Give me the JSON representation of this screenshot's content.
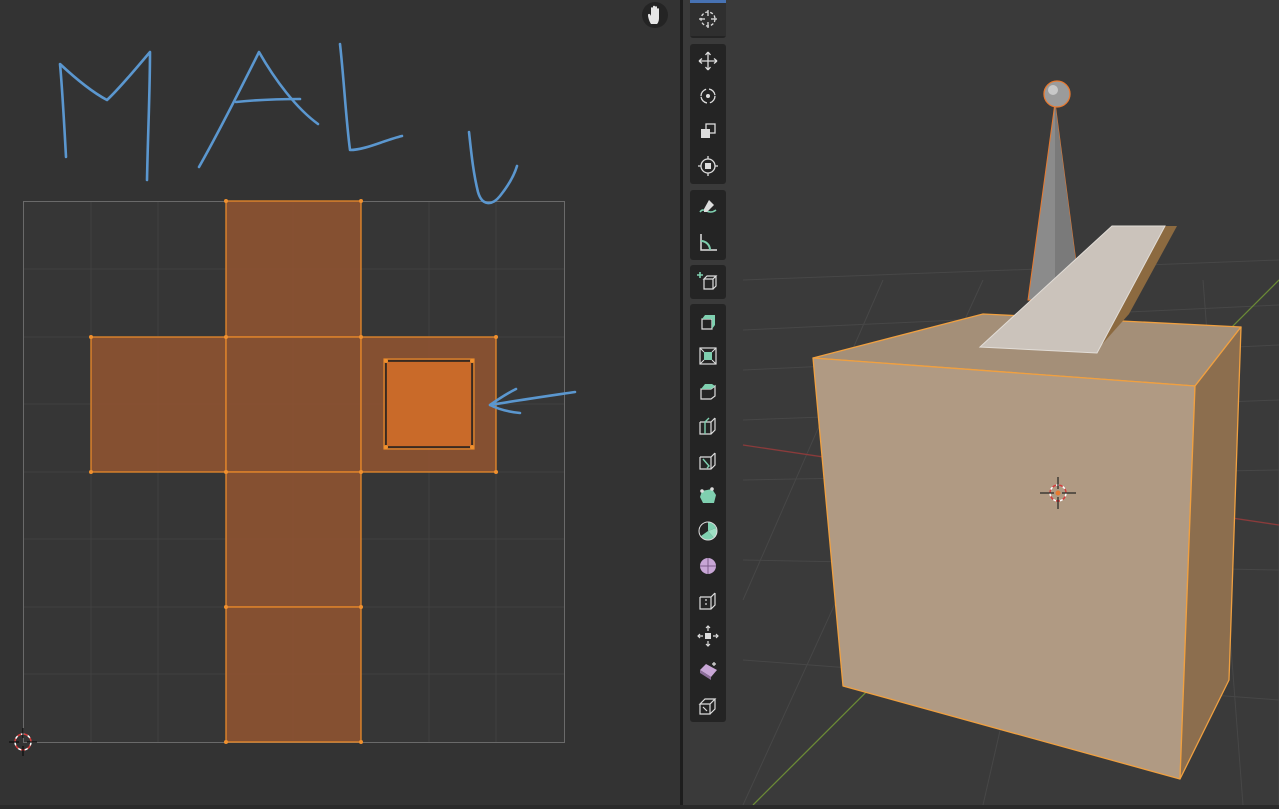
{
  "uv_editor": {
    "annotation_text": "MALY",
    "annotation_color": "#5b97cf",
    "face_color": "#8a5232",
    "selected_face_color": "#c96a29",
    "edge_color": "#e8892a"
  },
  "viewport": {
    "cube_color": "#b09a83",
    "edge_color": "#f0a040"
  },
  "toolbar": {
    "tools": [
      {
        "name": "cursor-tool-icon"
      },
      {
        "name": "move-tool-icon"
      },
      {
        "name": "rotate-tool-icon"
      },
      {
        "name": "scale-tool-icon"
      },
      {
        "name": "transform-tool-icon"
      },
      {
        "name": "annotate-tool-icon"
      },
      {
        "name": "measure-tool-icon"
      },
      {
        "name": "add-cube-tool-icon"
      },
      {
        "name": "extrude-region-tool-icon"
      },
      {
        "name": "inset-faces-tool-icon"
      },
      {
        "name": "bevel-tool-icon"
      },
      {
        "name": "loop-cut-tool-icon"
      },
      {
        "name": "knife-tool-icon"
      },
      {
        "name": "poly-build-tool-icon"
      },
      {
        "name": "spin-tool-icon"
      },
      {
        "name": "smooth-tool-icon"
      },
      {
        "name": "edge-slide-tool-icon"
      },
      {
        "name": "shrink-fatten-tool-icon"
      },
      {
        "name": "shear-tool-icon"
      },
      {
        "name": "rip-region-tool-icon"
      }
    ]
  }
}
